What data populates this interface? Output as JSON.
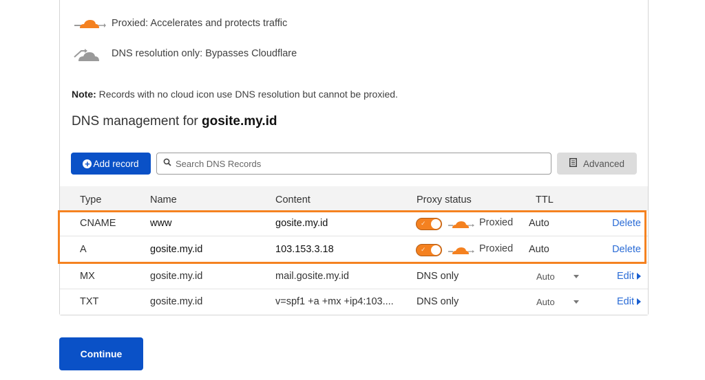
{
  "legend": {
    "proxied": {
      "icon": "orange-cloud-proxied-icon",
      "text": "Proxied: Accelerates and protects traffic"
    },
    "dns_only": {
      "icon": "gray-cloud-dns-only-icon",
      "text": "DNS resolution only: Bypasses Cloudflare"
    }
  },
  "note": {
    "label": "Note:",
    "text": " Records with no cloud icon use DNS resolution but cannot be proxied."
  },
  "heading": {
    "prefix": "DNS management for ",
    "domain": "gosite.my.id"
  },
  "toolbar": {
    "add_record_label": "Add record",
    "search_placeholder": "Search DNS Records",
    "search_value": "",
    "advanced_label": "Advanced"
  },
  "table": {
    "columns": [
      "Type",
      "Name",
      "Content",
      "Proxy status",
      "TTL"
    ],
    "rows": [
      {
        "type": "CNAME",
        "name": "www",
        "content": "gosite.my.id",
        "proxy_status": "Proxied",
        "proxied": true,
        "ttl": "Auto",
        "action": "Delete"
      },
      {
        "type": "A",
        "name": "gosite.my.id",
        "content": "103.153.3.18",
        "proxy_status": "Proxied",
        "proxied": true,
        "ttl": "Auto",
        "action": "Delete"
      },
      {
        "type": "MX",
        "name": "gosite.my.id",
        "content": "mail.gosite.my.id",
        "proxy_status": "DNS only",
        "proxied": false,
        "ttl": "Auto",
        "action": "Edit"
      },
      {
        "type": "TXT",
        "name": "gosite.my.id",
        "content": "v=spf1 +a +mx +ip4:103....",
        "proxy_status": "DNS only",
        "proxied": false,
        "ttl": "Auto",
        "action": "Edit"
      }
    ]
  },
  "highlight_color": "#f58220",
  "primary_color": "#0a51c7",
  "continue_label": "Continue"
}
